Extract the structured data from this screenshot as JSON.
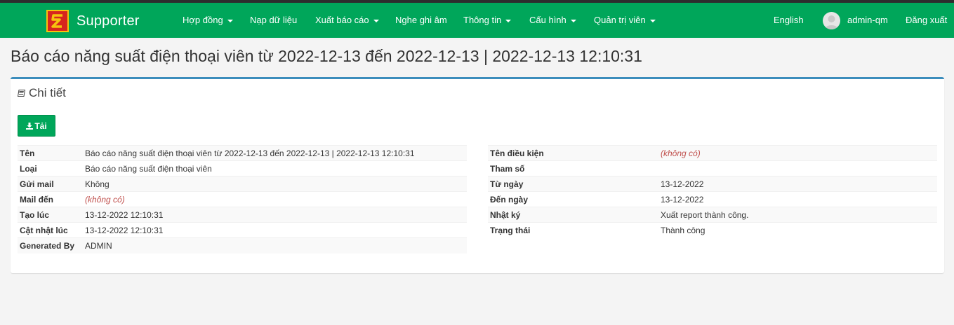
{
  "app": {
    "brand": "Supporter"
  },
  "nav": {
    "items": [
      {
        "label": "Hợp đồng",
        "dropdown": true
      },
      {
        "label": "Nạp dữ liệu",
        "dropdown": false
      },
      {
        "label": "Xuất báo cáo",
        "dropdown": true
      },
      {
        "label": "Nghe ghi âm",
        "dropdown": false
      },
      {
        "label": "Thông tin",
        "dropdown": true
      },
      {
        "label": "Cấu hình",
        "dropdown": true
      },
      {
        "label": "Quản trị viên",
        "dropdown": true
      }
    ],
    "language": "English",
    "username": "admin-qm",
    "logout": "Đăng xuất"
  },
  "page": {
    "title": "Báo cáo năng suất điện thoại viên từ 2022-12-13 đến 2022-12-13 | 2022-12-13 12:10:31"
  },
  "detail": {
    "title": "Chi tiết",
    "download_label": "Tải",
    "left": [
      {
        "key": "Tên",
        "value": "Báo cáo năng suất điện thoại viên từ 2022-12-13 đến 2022-12-13 | 2022-12-13 12:10:31"
      },
      {
        "key": "Loại",
        "value": "Báo cáo năng suất điện thoại viên"
      },
      {
        "key": "Gửi mail",
        "value": "Không"
      },
      {
        "key": "Mail đến",
        "value": "(không có)",
        "empty": true
      },
      {
        "key": "Tạo lúc",
        "value": "13-12-2022 12:10:31"
      },
      {
        "key": "Cật nhật lúc",
        "value": "13-12-2022 12:10:31"
      },
      {
        "key": "Generated By",
        "value": "ADMIN"
      }
    ],
    "right": [
      {
        "key": "Tên điều kiện",
        "value": "(không có)",
        "empty": true
      },
      {
        "key": "Tham số",
        "value": ""
      },
      {
        "key": "Từ ngày",
        "value": "13-12-2022"
      },
      {
        "key": "Đến ngày",
        "value": "13-12-2022"
      },
      {
        "key": "Nhật ký",
        "value": "Xuất report thành công."
      },
      {
        "key": "Trạng thái",
        "value": "Thành công"
      }
    ]
  },
  "colors": {
    "navbar": "#00a65a",
    "box_border": "#3c8dbc",
    "empty_value": "#c0504d",
    "logo_red": "#d7261e",
    "logo_yellow": "#f6c40e"
  }
}
